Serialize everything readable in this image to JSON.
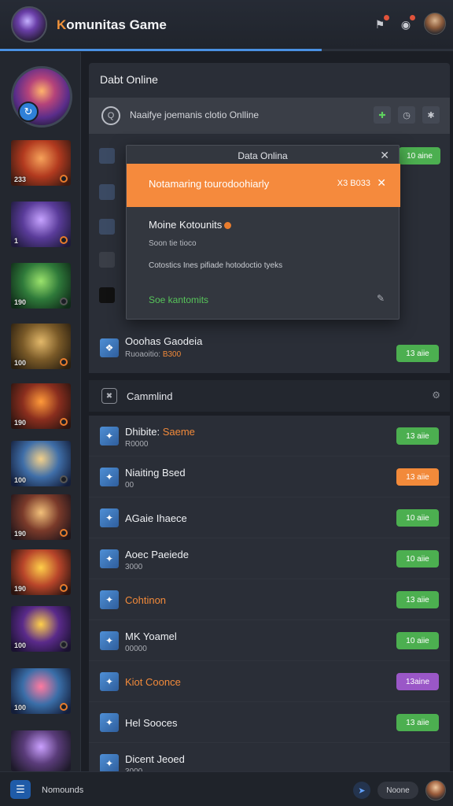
{
  "header": {
    "title_prefix": "K",
    "title_rest": "omunitas Game",
    "progress_fraction": 0.71,
    "icons": [
      "bookmark-icon",
      "game-controller-icon"
    ],
    "accent": "#4a90e2"
  },
  "rail": {
    "games": [
      {
        "num": "233"
      },
      {
        "num": "1"
      },
      {
        "num": "190"
      },
      {
        "num": "100"
      },
      {
        "num": "190"
      },
      {
        "num": "100"
      },
      {
        "num": "190"
      },
      {
        "num": "190"
      },
      {
        "num": "100"
      },
      {
        "num": "100"
      },
      {
        "num": ""
      }
    ]
  },
  "panel": {
    "title": "Dabt Online",
    "search_text": "Naaifye joemanis clotio Onlline"
  },
  "dialog": {
    "title": "Data Onlina",
    "toast_text": "Notamaring tourodoohiarly",
    "toast_code": "X3 B033",
    "heading": "Moine Kotounits",
    "sub": "Soon tie tioco",
    "desc": "Cotostics Ines pifiade hotodoctio tyeks",
    "link": "Soe kantomits"
  },
  "right_pill": "10 aine",
  "featured": {
    "title": "Ooohas Gaodeia",
    "sub_prefix": "Ruoaoitio:",
    "sub_hl": "B300",
    "pill": "13 aiie"
  },
  "section": {
    "title": "Cammlind"
  },
  "list": [
    {
      "title": "Dhibite:",
      "title_hl": "Saeme",
      "sub": "R0000",
      "pill": "13 aiie",
      "color": "green"
    },
    {
      "title": "Niaiting Bsed",
      "title_hl": "",
      "sub": "00",
      "pill": "13 aiie",
      "color": "orange"
    },
    {
      "title": "AGaie Ihaece",
      "title_hl": "",
      "sub": "",
      "pill": "10 aiie",
      "color": "green"
    },
    {
      "title": "Aoec Paeiede",
      "title_hl": "",
      "sub": "3000",
      "pill": "10 aiie",
      "color": "green"
    },
    {
      "title": "",
      "title_hl": "Cohtinon",
      "sub": "",
      "pill": "13 aiie",
      "color": "green"
    },
    {
      "title": "MK Yoamel",
      "title_hl": "",
      "sub": "00000",
      "pill": "10 aiie",
      "color": "green"
    },
    {
      "title": "",
      "title_hl": "Kiot Coonce",
      "sub": "",
      "pill": "13aine",
      "color": "purple"
    },
    {
      "title": "Hel Sooces",
      "title_hl": "",
      "sub": "",
      "pill": "13 aiie",
      "color": "green"
    },
    {
      "title": "Dicent Jeoed",
      "title_hl": "",
      "sub": "3000",
      "pill": "",
      "color": ""
    }
  ],
  "bottom": {
    "label": "Nomounds",
    "chip": "Noone"
  }
}
